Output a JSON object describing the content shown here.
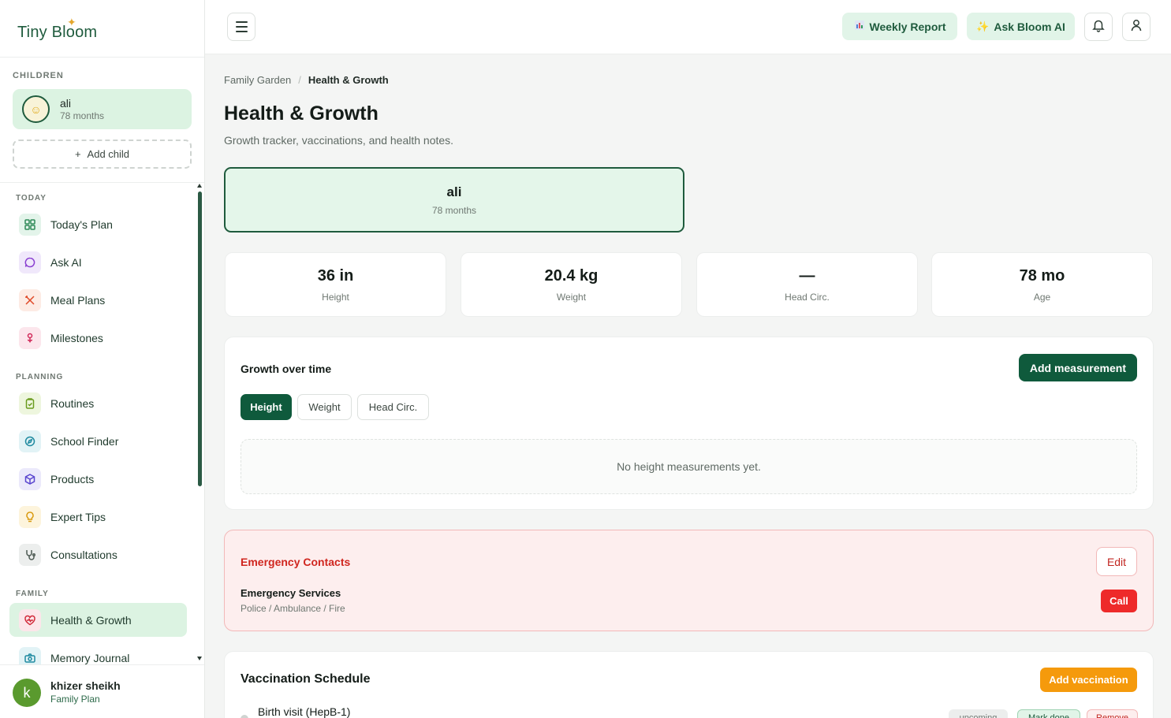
{
  "app": {
    "logo": "Tiny Bloom"
  },
  "sidebar": {
    "children_label": "CHILDREN",
    "child": {
      "name": "ali",
      "age": "78 months"
    },
    "add_child": "Add child",
    "sections": {
      "today": "TODAY",
      "planning": "PLANNING",
      "family": "FAMILY"
    },
    "items": [
      {
        "label": "Today's Plan",
        "icon": "grid-icon"
      },
      {
        "label": "Ask AI",
        "icon": "chat-icon"
      },
      {
        "label": "Meal Plans",
        "icon": "utensils-icon"
      },
      {
        "label": "Milestones",
        "icon": "flower-icon"
      },
      {
        "label": "Routines",
        "icon": "clipboard-icon"
      },
      {
        "label": "School Finder",
        "icon": "compass-icon"
      },
      {
        "label": "Products",
        "icon": "box-icon"
      },
      {
        "label": "Expert Tips",
        "icon": "lightbulb-icon"
      },
      {
        "label": "Consultations",
        "icon": "stethoscope-icon"
      },
      {
        "label": "Health & Growth",
        "icon": "heart-pulse-icon"
      },
      {
        "label": "Memory Journal",
        "icon": "camera-icon"
      }
    ],
    "user": {
      "initial": "k",
      "name": "khizer sheikh",
      "plan": "Family Plan"
    }
  },
  "topbar": {
    "weekly_report": "Weekly Report",
    "ask_bloom": "Ask Bloom AI"
  },
  "breadcrumb": {
    "parent": "Family Garden",
    "current": "Health & Growth"
  },
  "page": {
    "title": "Health & Growth",
    "subtitle": "Growth tracker, vaccinations, and health notes."
  },
  "selected_child": {
    "name": "ali",
    "age": "78 months"
  },
  "stats": [
    {
      "value": "36 in",
      "label": "Height"
    },
    {
      "value": "20.4 kg",
      "label": "Weight"
    },
    {
      "value": "—",
      "label": "Head Circ."
    },
    {
      "value": "78 mo",
      "label": "Age"
    }
  ],
  "growth": {
    "title": "Growth over time",
    "add_button": "Add measurement",
    "tabs": [
      "Height",
      "Weight",
      "Head Circ."
    ],
    "active_tab": "Height",
    "empty": "No height measurements yet."
  },
  "emergency": {
    "title": "Emergency Contacts",
    "edit": "Edit",
    "service_name": "Emergency Services",
    "service_desc": "Police / Ambulance / Fire",
    "call": "Call"
  },
  "vaccination": {
    "title": "Vaccination Schedule",
    "add_button": "Add vaccination",
    "rows": [
      {
        "name": "Birth visit (HepB-1)",
        "status": "upcoming",
        "mark_done": "Mark done",
        "remove": "Remove"
      }
    ]
  },
  "colors": {
    "brand": "#1f5b3d",
    "primary_button": "#0f5a3c",
    "active_bg": "#dcf3e2",
    "danger": "#ee2a2a",
    "warning": "#f59a0c"
  }
}
